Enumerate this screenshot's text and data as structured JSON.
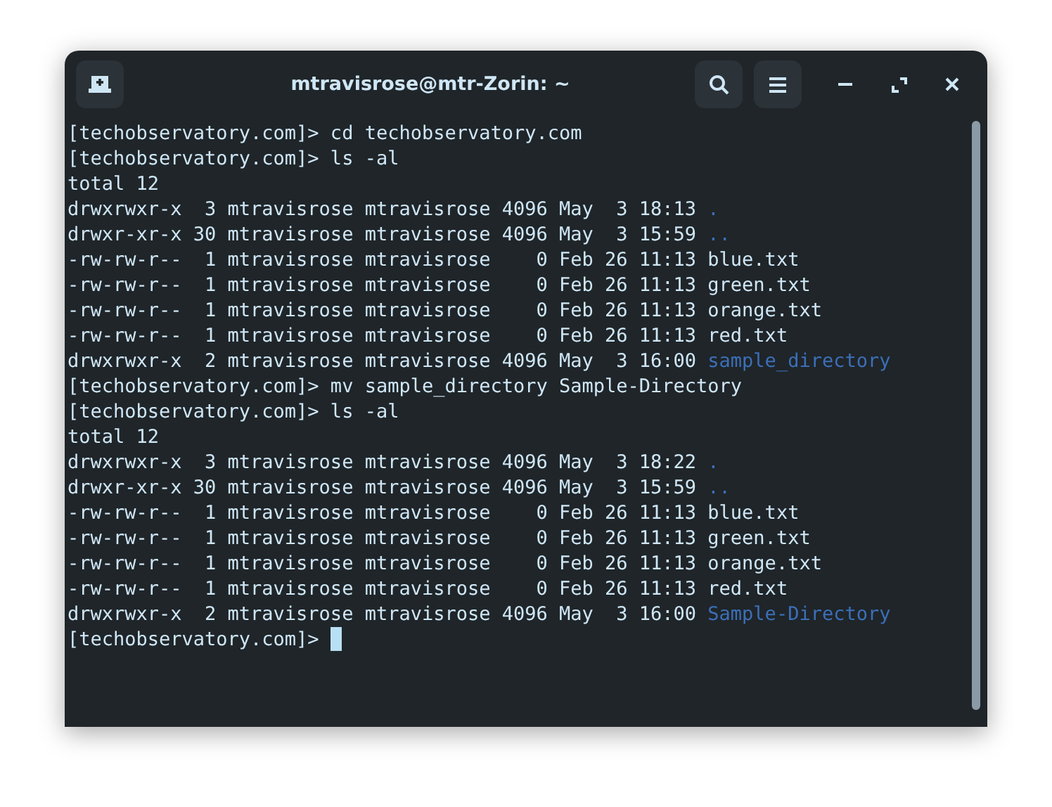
{
  "window": {
    "title": "mtravisrose@mtr-Zorin: ~"
  },
  "terminal": {
    "lines": [
      {
        "kind": "prompt",
        "prompt": "[techobservatory.com]>",
        "command": "cd techobservatory.com"
      },
      {
        "kind": "prompt",
        "prompt": "[techobservatory.com]>",
        "command": "ls -al"
      },
      {
        "kind": "output",
        "text": "total 12"
      },
      {
        "kind": "entry",
        "info": "drwxrwxr-x  3 mtravisrose mtravisrose 4096 May  3 18:13",
        "name": ".",
        "color": "#3c6fb8"
      },
      {
        "kind": "entry",
        "info": "drwxr-xr-x 30 mtravisrose mtravisrose 4096 May  3 15:59",
        "name": "..",
        "color": "#3c6fb8"
      },
      {
        "kind": "entry",
        "info": "-rw-rw-r--  1 mtravisrose mtravisrose    0 Feb 26 11:13",
        "name": "blue.txt",
        "color": "#cfe6f5"
      },
      {
        "kind": "entry",
        "info": "-rw-rw-r--  1 mtravisrose mtravisrose    0 Feb 26 11:13",
        "name": "green.txt",
        "color": "#cfe6f5"
      },
      {
        "kind": "entry",
        "info": "-rw-rw-r--  1 mtravisrose mtravisrose    0 Feb 26 11:13",
        "name": "orange.txt",
        "color": "#cfe6f5"
      },
      {
        "kind": "entry",
        "info": "-rw-rw-r--  1 mtravisrose mtravisrose    0 Feb 26 11:13",
        "name": "red.txt",
        "color": "#cfe6f5"
      },
      {
        "kind": "entry",
        "info": "drwxrwxr-x  2 mtravisrose mtravisrose 4096 May  3 16:00",
        "name": "sample_directory",
        "color": "#3c6fb8"
      },
      {
        "kind": "prompt",
        "prompt": "[techobservatory.com]>",
        "command": "mv sample_directory Sample-Directory"
      },
      {
        "kind": "prompt",
        "prompt": "[techobservatory.com]>",
        "command": "ls -al"
      },
      {
        "kind": "output",
        "text": "total 12"
      },
      {
        "kind": "entry",
        "info": "drwxrwxr-x  3 mtravisrose mtravisrose 4096 May  3 18:22",
        "name": ".",
        "color": "#3c6fb8"
      },
      {
        "kind": "entry",
        "info": "drwxr-xr-x 30 mtravisrose mtravisrose 4096 May  3 15:59",
        "name": "..",
        "color": "#3c6fb8"
      },
      {
        "kind": "entry",
        "info": "-rw-rw-r--  1 mtravisrose mtravisrose    0 Feb 26 11:13",
        "name": "blue.txt",
        "color": "#cfe6f5"
      },
      {
        "kind": "entry",
        "info": "-rw-rw-r--  1 mtravisrose mtravisrose    0 Feb 26 11:13",
        "name": "green.txt",
        "color": "#cfe6f5"
      },
      {
        "kind": "entry",
        "info": "-rw-rw-r--  1 mtravisrose mtravisrose    0 Feb 26 11:13",
        "name": "orange.txt",
        "color": "#cfe6f5"
      },
      {
        "kind": "entry",
        "info": "-rw-rw-r--  1 mtravisrose mtravisrose    0 Feb 26 11:13",
        "name": "red.txt",
        "color": "#cfe6f5"
      },
      {
        "kind": "entry",
        "info": "drwxrwxr-x  2 mtravisrose mtravisrose 4096 May  3 16:00",
        "name": "Sample-Directory",
        "color": "#3c6fb8"
      },
      {
        "kind": "cursor",
        "prompt": "[techobservatory.com]>"
      }
    ]
  }
}
